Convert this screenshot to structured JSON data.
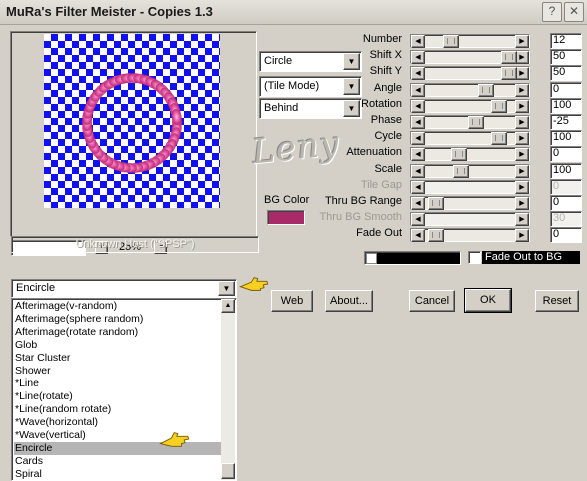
{
  "window": {
    "title": "MuRa's Filter Meister - Copies 1.3"
  },
  "zoom": {
    "value": "25%",
    "plus": "+",
    "minus": "−"
  },
  "host_status": "Unknown Host (\"SPSP\")",
  "watermark": "Leny",
  "dropdowns": {
    "shape": "Circle",
    "tile_mode": "(Tile Mode)",
    "blend": "Behind"
  },
  "bg_color": {
    "label": "BG Color",
    "color": "#a82a68"
  },
  "params": [
    {
      "label": "Number",
      "value": "12",
      "enabled": true
    },
    {
      "label": "Shift X",
      "value": "50",
      "enabled": true
    },
    {
      "label": "Shift Y",
      "value": "50",
      "enabled": true
    },
    {
      "label": "Angle",
      "value": "0",
      "enabled": true
    },
    {
      "label": "Rotation",
      "value": "100",
      "enabled": true
    },
    {
      "label": "Phase",
      "value": "-25",
      "enabled": true
    },
    {
      "label": "Cycle",
      "value": "100",
      "enabled": true
    },
    {
      "label": "Attenuation",
      "value": "0",
      "enabled": true
    },
    {
      "label": "Scale",
      "value": "100",
      "enabled": true
    },
    {
      "label": "Tile Gap",
      "value": "0",
      "enabled": false
    },
    {
      "label": "Thru BG Range",
      "value": "0",
      "enabled": true
    },
    {
      "label": "Thru BG Smooth",
      "value": "30",
      "enabled": false
    },
    {
      "label": "Fade Out",
      "value": "0",
      "enabled": true
    }
  ],
  "fade_out_bg": {
    "label": "Fade Out to BG",
    "checked": false
  },
  "preset_combo": {
    "value": "Encircle"
  },
  "buttons": {
    "web": "Web",
    "about": "About...",
    "cancel": "Cancel",
    "ok": "OK",
    "reset": "Reset"
  },
  "preset_list": {
    "items": [
      "Afterimage(v-random)",
      "Afterimage(sphere random)",
      "Afterimage(rotate random)",
      "Glob",
      "Star Cluster",
      "Shower",
      "*Line",
      "*Line(rotate)",
      "*Line(random rotate)",
      "*Wave(horizontal)",
      "*Wave(vertical)",
      "Encircle",
      "Cards",
      "Spiral"
    ],
    "selected": "Encircle"
  },
  "colors": {
    "checker_blue": "#1010f0",
    "ring_pink": "#e04c9a",
    "pointer_yellow": "#f5d020"
  }
}
